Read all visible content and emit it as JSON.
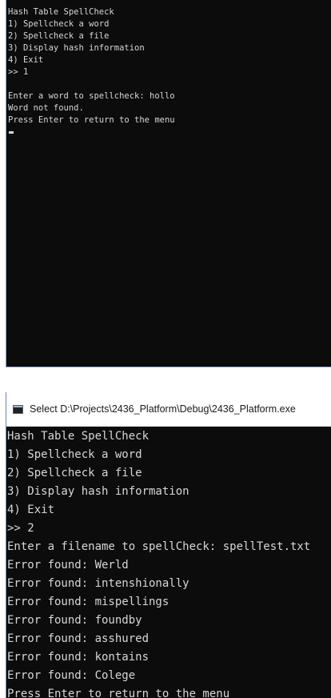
{
  "console1": {
    "lines": [
      "Hash Table SpellCheck",
      "1) Spellcheck a word",
      "2) Spellcheck a file",
      "3) Display hash information",
      "4) Exit",
      ">> 1",
      "",
      "Enter a word to spellcheck: hollo",
      "Word not found.",
      "Press Enter to return to the menu"
    ]
  },
  "window2": {
    "title": "Select D:\\Projects\\2436_Platform\\Debug\\2436_Platform.exe",
    "icon": "console-app-icon",
    "lines": [
      "Hash Table SpellCheck",
      "1) Spellcheck a word",
      "2) Spellcheck a file",
      "3) Display hash information",
      "4) Exit",
      ">> 2",
      "Enter a filename to spellCheck: spellTest.txt",
      "Error found: Werld",
      "Error found: intenshionally",
      "Error found: mispellings",
      "Error found: foundby",
      "Error found: asshured",
      "Error found: kontains",
      "Error found: Colege",
      "Press Enter to return to the menu"
    ]
  },
  "colors": {
    "console_bg": "#0c0c0c",
    "console_text": "#d7d7d7",
    "window_border": "#6b86b0"
  }
}
